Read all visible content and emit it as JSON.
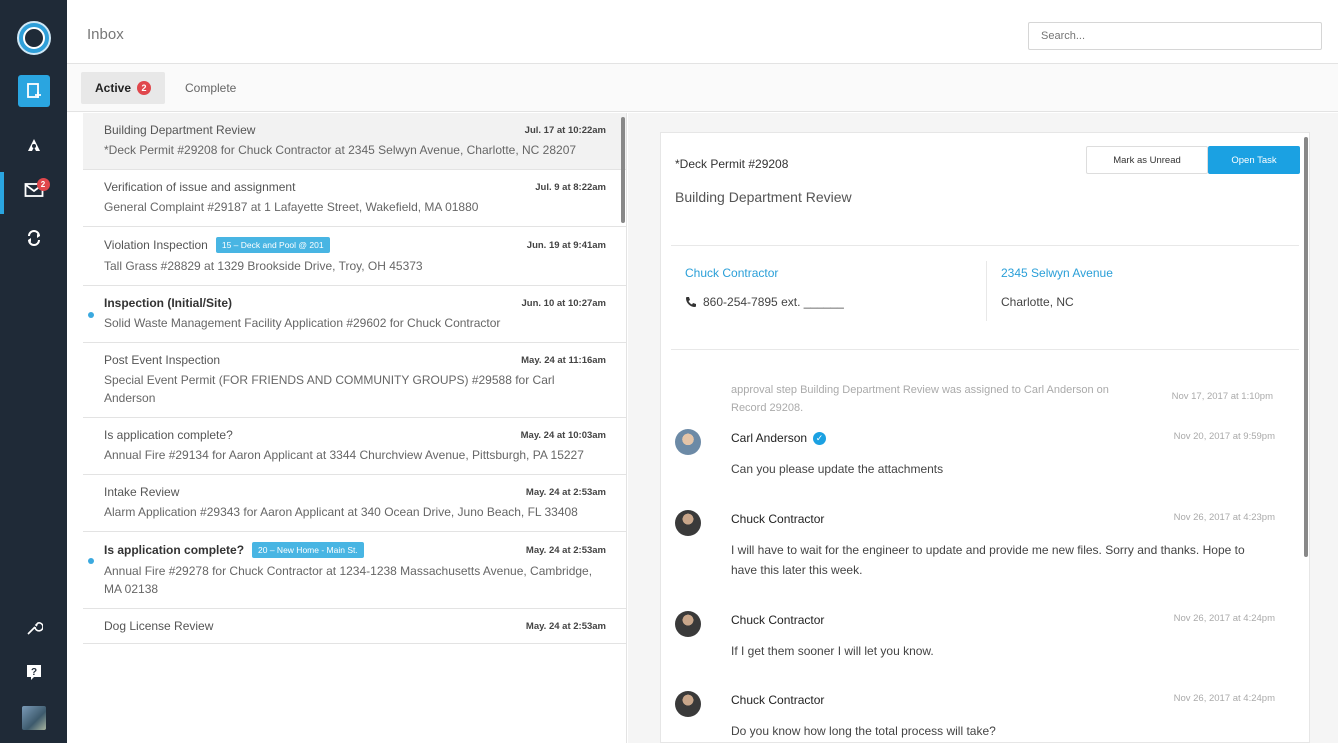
{
  "header": {
    "title": "Inbox",
    "search_placeholder": "Search..."
  },
  "sidebar": {
    "inbox_badge": "2",
    "items": [
      {
        "name": "logo",
        "icon": "seal-logo"
      },
      {
        "name": "new",
        "icon": "new-record-icon"
      },
      {
        "name": "people",
        "icon": "people-icon"
      },
      {
        "name": "inbox",
        "icon": "mail-icon"
      },
      {
        "name": "sync",
        "icon": "sync-icon"
      },
      {
        "name": "settings",
        "icon": "wrench-icon"
      },
      {
        "name": "help",
        "icon": "help-icon"
      },
      {
        "name": "user",
        "icon": "avatar"
      }
    ]
  },
  "tabs": {
    "active_label": "Active",
    "active_count": "2",
    "complete_label": "Complete"
  },
  "list": [
    {
      "title": "Building Department Review",
      "date": "Jul. 17 at 10:22am",
      "sub": "*Deck Permit #29208 for Chuck Contractor at 2345 Selwyn Avenue, Charlotte, NC 28207",
      "tag": "",
      "bold": false,
      "unread": false,
      "selected": true
    },
    {
      "title": "Verification of issue and assignment",
      "date": "Jul. 9 at 8:22am",
      "sub": "General Complaint #29187 at 1 Lafayette Street, Wakefield, MA 01880",
      "tag": "",
      "bold": false,
      "unread": false,
      "selected": false
    },
    {
      "title": "Violation Inspection",
      "date": "Jun. 19 at 9:41am",
      "sub": "Tall Grass #28829 at 1329 Brookside Drive, Troy, OH 45373",
      "tag": "15 – Deck and Pool @ 201",
      "bold": false,
      "unread": false,
      "selected": false
    },
    {
      "title": "Inspection (Initial/Site)",
      "date": "Jun. 10 at 10:27am",
      "sub": "Solid Waste Management Facility Application #29602 for Chuck Contractor",
      "tag": "",
      "bold": true,
      "unread": true,
      "selected": false
    },
    {
      "title": "Post Event Inspection",
      "date": "May. 24 at 11:16am",
      "sub": "Special Event Permit (FOR FRIENDS AND COMMUNITY GROUPS) #29588 for Carl Anderson",
      "tag": "",
      "bold": false,
      "unread": false,
      "selected": false
    },
    {
      "title": "Is application complete?",
      "date": "May. 24 at 10:03am",
      "sub": "Annual Fire #29134 for Aaron Applicant at 3344 Churchview Avenue, Pittsburgh, PA 15227",
      "tag": "",
      "bold": false,
      "unread": false,
      "selected": false
    },
    {
      "title": "Intake Review",
      "date": "May. 24 at 2:53am",
      "sub": "Alarm Application #29343 for Aaron Applicant at 340 Ocean Drive, Juno Beach, FL 33408",
      "tag": "",
      "bold": false,
      "unread": false,
      "selected": false
    },
    {
      "title": "Is application complete?",
      "date": "May. 24 at 2:53am",
      "sub": "Annual Fire #29278 for Chuck Contractor at 1234-1238 Massachusetts Avenue, Cambridge, MA 02138",
      "tag": "20 – New Home - Main St.",
      "bold": true,
      "unread": true,
      "selected": false
    },
    {
      "title": "Dog License Review",
      "date": "May. 24 at 2:53am",
      "sub": "",
      "tag": "",
      "bold": false,
      "unread": false,
      "selected": false
    }
  ],
  "detail": {
    "permit": "*Deck Permit #29208",
    "title": "Building Department Review",
    "mark_unread_label": "Mark as Unread",
    "open_task_label": "Open Task",
    "contact_name": "Chuck Contractor",
    "phone": "860-254-7895 ext. ______",
    "address": "2345 Selwyn Avenue",
    "city": "Charlotte, NC",
    "system_message": "approval step Building Department Review was assigned to Carl Anderson on Record 29208.",
    "system_time": "Nov 17, 2017 at 1:10pm",
    "messages": [
      {
        "name": "Carl Anderson",
        "verified": true,
        "time": "Nov 20, 2017 at 9:59pm",
        "text": "Can you please update the attachments"
      },
      {
        "name": "Chuck Contractor",
        "verified": false,
        "time": "Nov 26, 2017 at 4:23pm",
        "text": "I will have to wait for the engineer to update and provide me new files. Sorry and thanks. Hope to have this later this week."
      },
      {
        "name": "Chuck Contractor",
        "verified": false,
        "time": "Nov 26, 2017 at 4:24pm",
        "text": "If I get them sooner I will let you know."
      },
      {
        "name": "Chuck Contractor",
        "verified": false,
        "time": "Nov 26, 2017 at 4:24pm",
        "text": "Do you know how long the total process will take?"
      }
    ]
  },
  "colors": {
    "sidebar_bg": "#1f2a37",
    "accent": "#1ba1e2",
    "badge": "#e0474c"
  }
}
